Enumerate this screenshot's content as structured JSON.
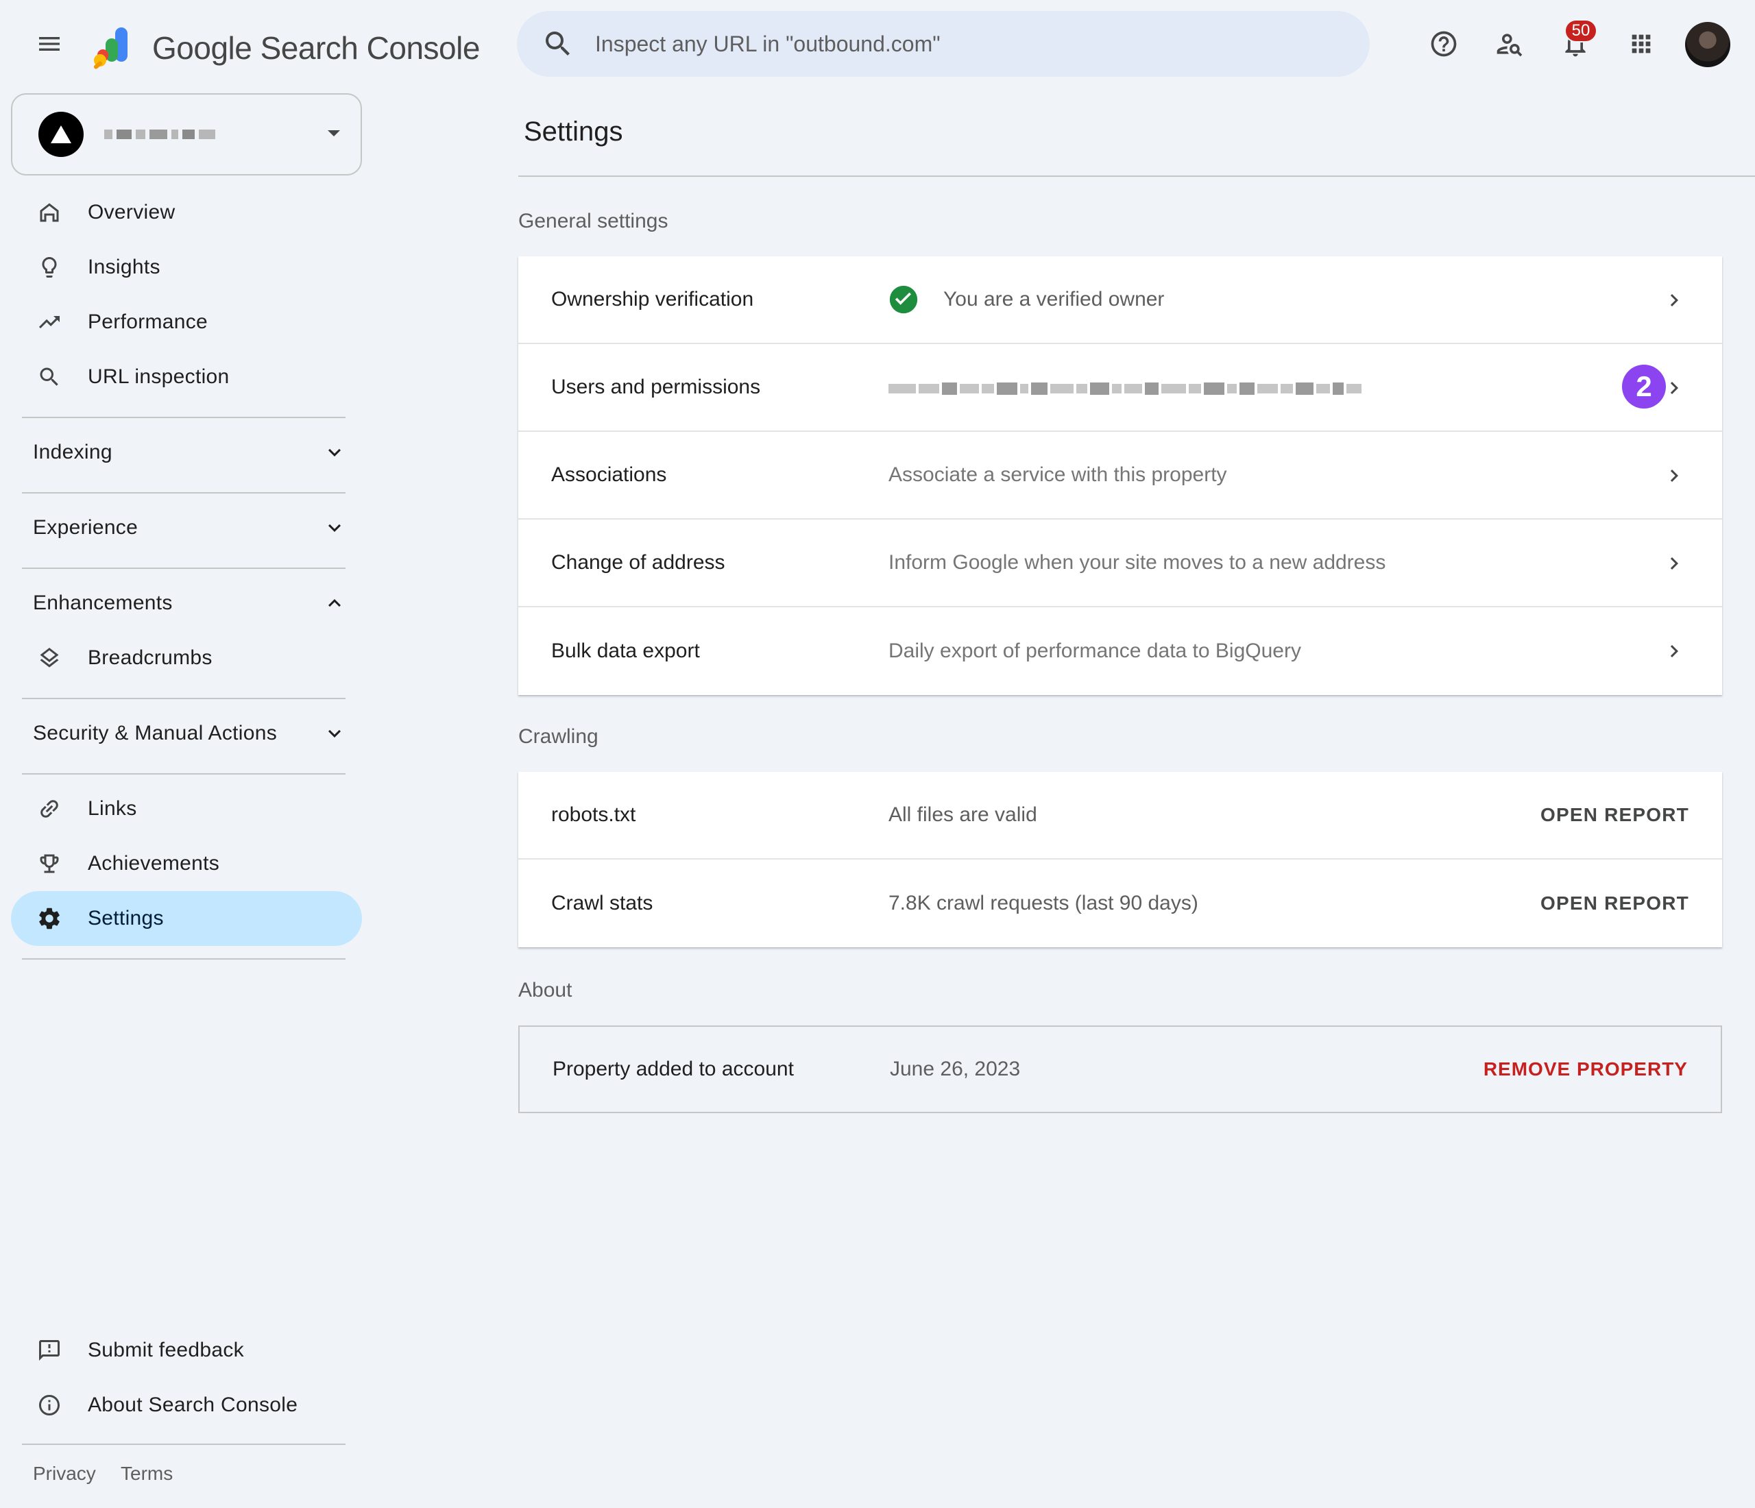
{
  "header": {
    "brand": "Google Search Console",
    "search_placeholder": "Inspect any URL in \"outbound.com\"",
    "notification_count": "50"
  },
  "sidebar": {
    "top_items": [
      {
        "label": "Overview",
        "icon": "home-icon"
      },
      {
        "label": "Insights",
        "icon": "lightbulb-icon"
      },
      {
        "label": "Performance",
        "icon": "trending-up-icon"
      },
      {
        "label": "URL inspection",
        "icon": "search-icon"
      }
    ],
    "sections": {
      "indexing": "Indexing",
      "experience": "Experience",
      "enhancements": "Enhancements",
      "security": "Security & Manual Actions"
    },
    "enhancement_items": [
      {
        "label": "Breadcrumbs",
        "icon": "layers-icon"
      }
    ],
    "bottom_items": [
      {
        "label": "Links",
        "icon": "link-icon"
      },
      {
        "label": "Achievements",
        "icon": "trophy-icon"
      },
      {
        "label": "Settings",
        "icon": "gear-icon"
      }
    ],
    "footer_items": [
      {
        "label": "Submit feedback",
        "icon": "feedback-icon"
      },
      {
        "label": "About Search Console",
        "icon": "info-icon"
      }
    ],
    "privacy": "Privacy",
    "terms": "Terms"
  },
  "main": {
    "title": "Settings",
    "general": {
      "heading": "General settings",
      "rows": [
        {
          "label": "Ownership verification",
          "value": "You are a verified owner"
        },
        {
          "label": "Users and permissions",
          "value": ""
        },
        {
          "label": "Associations",
          "value": "Associate a service with this property"
        },
        {
          "label": "Change of address",
          "value": "Inform Google when your site moves to a new address"
        },
        {
          "label": "Bulk data export",
          "value": "Daily export of performance data to BigQuery"
        }
      ],
      "step_badge": "2"
    },
    "crawling": {
      "heading": "Crawling",
      "rows": [
        {
          "label": "robots.txt",
          "value": "All files are valid",
          "action": "OPEN REPORT"
        },
        {
          "label": "Crawl stats",
          "value": "7.8K crawl requests (last 90 days)",
          "action": "OPEN REPORT"
        }
      ]
    },
    "about": {
      "heading": "About",
      "label": "Property added to account",
      "value": "June 26, 2023",
      "action": "REMOVE PROPERTY"
    }
  },
  "colors": {
    "background": "#f0f4f9",
    "active_nav": "#c2e7ff",
    "verified_green": "#1e8e3e",
    "danger_red": "#c5221f",
    "step_badge_purple": "#8b44f0"
  }
}
